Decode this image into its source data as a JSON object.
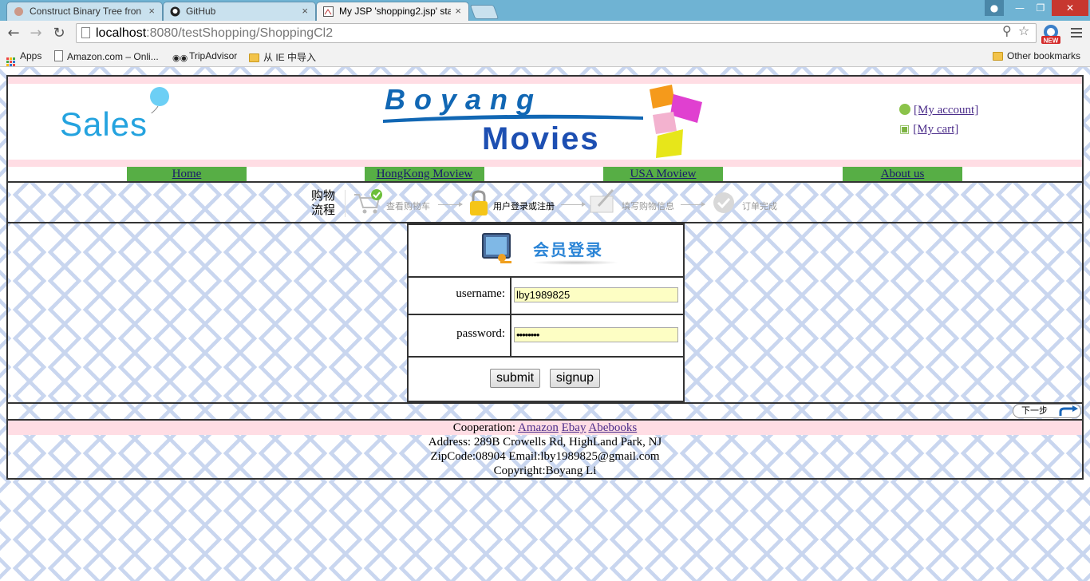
{
  "browser": {
    "tabs": [
      {
        "title": "Construct Binary Tree fron",
        "active": false
      },
      {
        "title": "GitHub",
        "active": false
      },
      {
        "title": "My JSP 'shopping2.jsp' sta",
        "active": true
      }
    ],
    "close_glyph": "×",
    "url_host": "localhost",
    "url_path": ":8080/testShopping/ShoppingCl2",
    "new_badge": "NEW",
    "bookmarks": [
      {
        "label": "Apps",
        "icon": "apps-grid-icon"
      },
      {
        "label": "Amazon.com – Onli...",
        "icon": "page-icon"
      },
      {
        "label": "TripAdvisor",
        "icon": "tripadvisor-icon"
      },
      {
        "label": "从 IE 中导入",
        "icon": "folder-icon"
      }
    ],
    "other_bookmarks": "Other bookmarks"
  },
  "header": {
    "logo_text": "Sales",
    "brand_top": "Boyang",
    "brand_bottom": "Movies",
    "my_account": "[My account]",
    "my_cart": "[My cart]"
  },
  "nav": [
    {
      "label": "Home"
    },
    {
      "label": "HongKong Moview"
    },
    {
      "label": "USA Moview"
    },
    {
      "label": "About us"
    }
  ],
  "progress": {
    "title": "购物流程",
    "steps": [
      {
        "label": "查看购物车",
        "current": false
      },
      {
        "label": "用户登录或注册",
        "current": true
      },
      {
        "label": "填写购物信息",
        "current": false
      },
      {
        "label": "订单完成",
        "current": false
      }
    ]
  },
  "login": {
    "heading": "会员登录",
    "username_label": "username:",
    "username_value": "lby1989825",
    "password_label": "password:",
    "password_value": "••••••••",
    "submit_label": "submit",
    "signup_label": "signup"
  },
  "next_step": "下一步",
  "footer": {
    "cooperation_label": "Cooperation:",
    "partners": [
      "Amazon",
      "Ebay",
      "Abebooks"
    ],
    "address": "Address: 289B Crowells Rd, HighLand Park, NJ",
    "contact": "ZipCode:08904 Email:lby1989825@gmail.com",
    "copyright": "Copyright:Boyang Li"
  },
  "colors": {
    "nav_green": "#57ae45",
    "pink_band": "#ffdde4",
    "link_purple": "#4b2c8a",
    "input_yellow": "#fdfec4",
    "tabstrip_blue": "#6fb3d3"
  }
}
